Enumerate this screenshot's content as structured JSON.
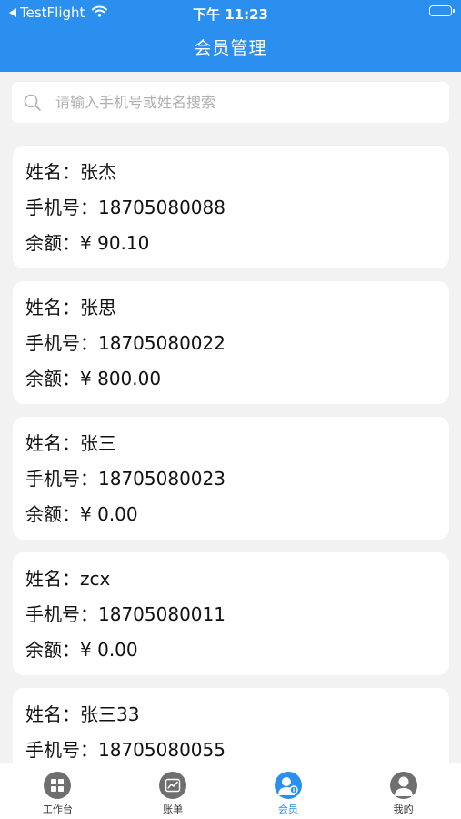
{
  "status_bar": {
    "carrier": "TestFlight",
    "time": "下午 11:23"
  },
  "nav": {
    "title": "会员管理"
  },
  "search": {
    "placeholder": "请输入手机号或姓名搜索"
  },
  "labels": {
    "name": "姓名：",
    "phone": "手机号：",
    "balance": "余额：",
    "currency": "¥ "
  },
  "members": [
    {
      "name": "张杰",
      "phone": "18705080088",
      "balance": "90.10"
    },
    {
      "name": "张思",
      "phone": "18705080022",
      "balance": "800.00"
    },
    {
      "name": "张三",
      "phone": "18705080023",
      "balance": "0.00"
    },
    {
      "name": "zcx",
      "phone": "18705080011",
      "balance": "0.00"
    },
    {
      "name": "张三33",
      "phone": "18705080055",
      "balance": ""
    }
  ],
  "tabs": [
    {
      "label": "工作台",
      "icon": "grid-icon",
      "active": false
    },
    {
      "label": "账单",
      "icon": "chart-icon",
      "active": false
    },
    {
      "label": "会员",
      "icon": "member-icon",
      "active": true
    },
    {
      "label": "我的",
      "icon": "profile-icon",
      "active": false
    }
  ],
  "colors": {
    "primary": "#2b8ff0",
    "background": "#f2f2f2",
    "tab_inactive": "#6f6f6f"
  }
}
